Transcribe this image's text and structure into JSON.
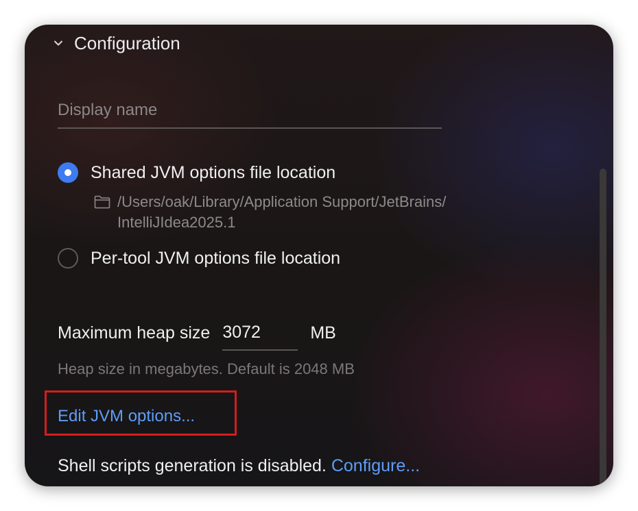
{
  "section": {
    "title": "Configuration",
    "expanded": true,
    "icon": "chevron-down-icon"
  },
  "display_name": {
    "value": "",
    "placeholder": "Display name"
  },
  "jvm_location": {
    "shared_label": "Shared JVM options file location",
    "shared_selected": true,
    "shared_path": "/Users/oak/Library/Application Support/JetBrains/\nIntelliJIdea2025.1",
    "path_icon": "folder-icon",
    "per_tool_label": "Per-tool JVM options file location",
    "per_tool_selected": false
  },
  "heap": {
    "label": "Maximum heap size",
    "value": "3072",
    "unit": "MB",
    "hint": "Heap size in megabytes. Default is 2048 MB"
  },
  "edit_jvm": {
    "label": "Edit JVM options..."
  },
  "shell": {
    "text": "Shell scripts generation is disabled.",
    "link": "Configure..."
  },
  "colors": {
    "accent": "#3e7bf0",
    "link": "#5f9df7",
    "highlight": "#d51d1d"
  }
}
